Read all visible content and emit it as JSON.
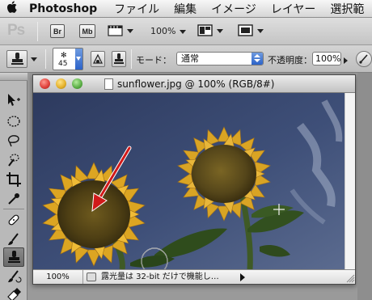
{
  "menubar": {
    "app_name": "Photoshop",
    "items": [
      "ファイル",
      "編集",
      "イメージ",
      "レイヤー",
      "選択範"
    ]
  },
  "appbar": {
    "logo": "Ps",
    "bridge_label": "Br",
    "minibridge_label": "Mb",
    "zoom_value": "100%"
  },
  "options": {
    "brush_size": "45",
    "mode_label": "モード：",
    "mode_value": "通常",
    "opacity_label": "不透明度：",
    "opacity_value": "100%"
  },
  "document": {
    "title": "sunflower.jpg @ 100% (RGB/8#)",
    "zoom": "100%",
    "status": "露光量は 32-bit だけで機能し…"
  },
  "colors": {
    "sky": "#3d4c70",
    "arrow": "#d11a1a",
    "petal": "#e0a820",
    "close_light": "#e0443e",
    "minimize_light": "#e6b32e",
    "zoom_light": "#5fb14a"
  }
}
